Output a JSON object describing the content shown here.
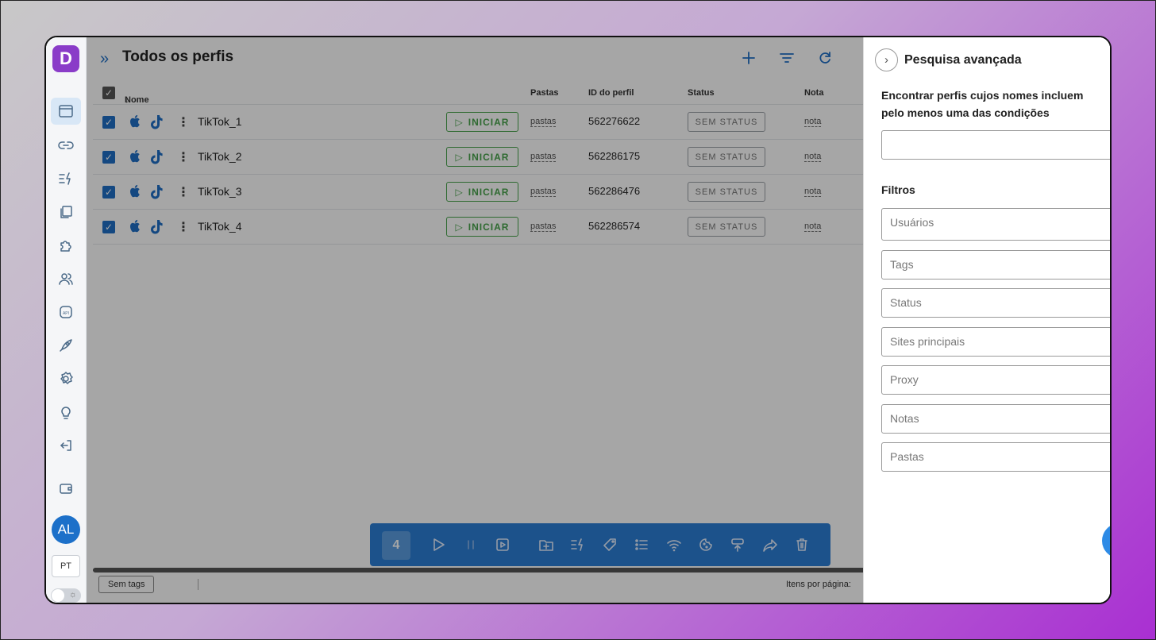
{
  "sidebar": {
    "logo": "D",
    "icons": [
      "browser-icon",
      "link-icon",
      "automation-icon",
      "copy-icon",
      "extension-icon",
      "users-icon",
      "api-icon",
      "rocket-icon",
      "settings-icon",
      "lightbulb-icon",
      "logout-icon",
      "wallet-icon"
    ],
    "avatar": "AL",
    "lang": "PT"
  },
  "header": {
    "title": "Todos os perfis"
  },
  "table": {
    "columns": {
      "name": "Nome",
      "folders": "Pastas",
      "profile_id": "ID do perfil",
      "status": "Status",
      "notes": "Nota"
    },
    "rows": [
      {
        "name": "TikTok_1",
        "start": "INICIAR",
        "folder": "pastas",
        "id": "562276622",
        "status": "SEM STATUS",
        "note": "nota"
      },
      {
        "name": "TikTok_2",
        "start": "INICIAR",
        "folder": "pastas",
        "id": "562286175",
        "status": "SEM STATUS",
        "note": "nota"
      },
      {
        "name": "TikTok_3",
        "start": "INICIAR",
        "folder": "pastas",
        "id": "562286476",
        "status": "SEM STATUS",
        "note": "nota"
      },
      {
        "name": "TikTok_4",
        "start": "INICIAR",
        "folder": "pastas",
        "id": "562286574",
        "status": "SEM STATUS",
        "note": "nota"
      }
    ]
  },
  "footer": {
    "tag_button": "Sem tags",
    "per_page_label": "Itens por página:"
  },
  "bulk_bar": {
    "selected_count": "4"
  },
  "panel": {
    "title": "Pesquisa avançada",
    "description": "Encontrar perfis cujos nomes incluem pelo menos uma das condições",
    "search_value": "",
    "filters_title": "Filtros",
    "filters": {
      "users": "Usuários",
      "tags": "Tags",
      "status": "Status",
      "sites": "Sites principais",
      "proxy": "Proxy",
      "notes": "Notas",
      "folders": "Pastas"
    }
  },
  "colors": {
    "accent": "#1f6fc7",
    "start_green": "#47a34b",
    "bulk_bar": "#2b7fd6",
    "logo": "#8a3cc8"
  }
}
